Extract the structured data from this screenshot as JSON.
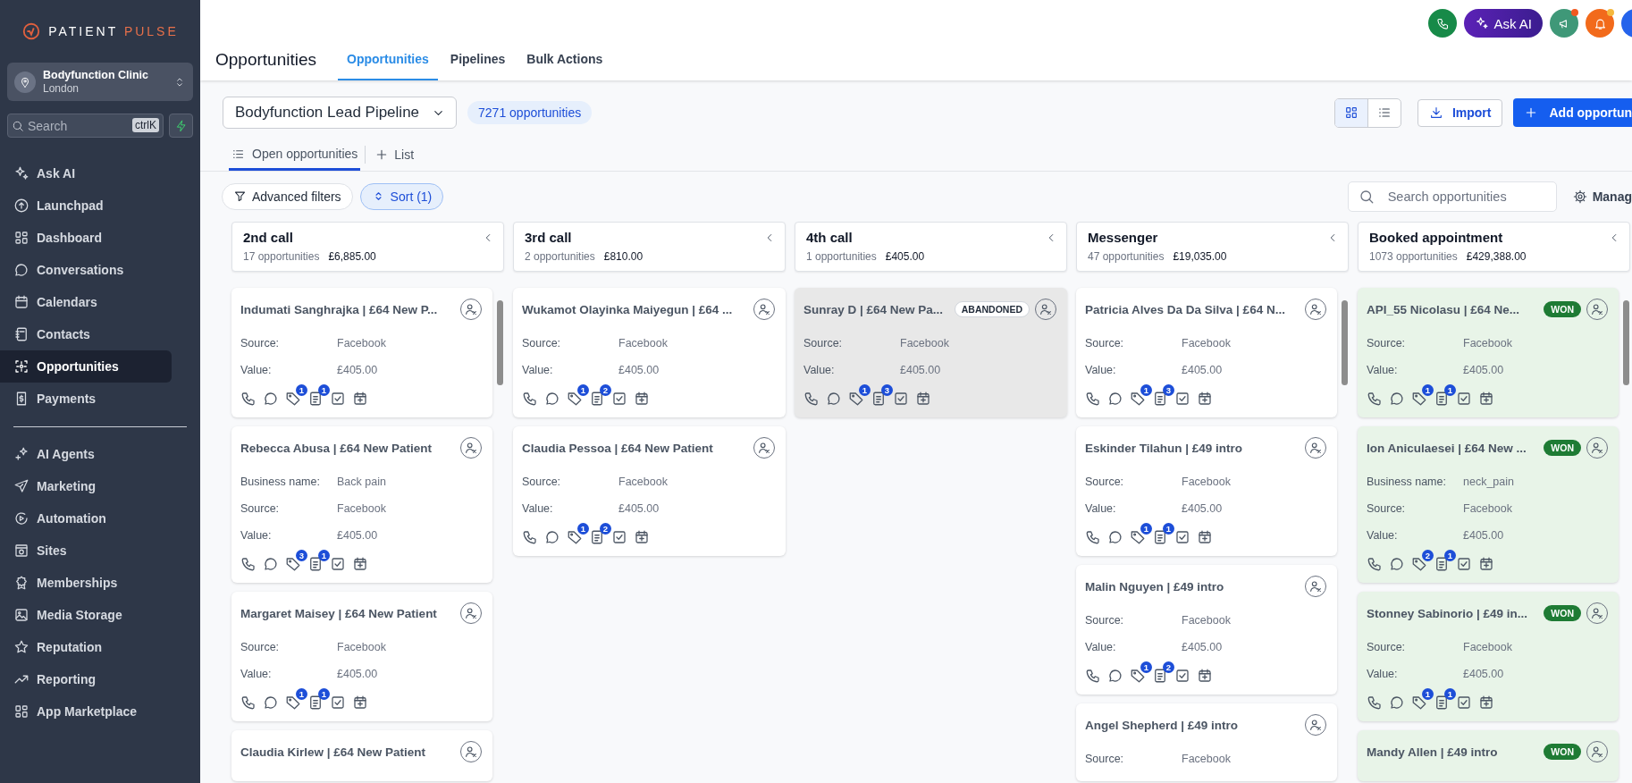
{
  "sidebar": {
    "logo": {
      "word_1": "PATIENT",
      "word_2": "PULSE"
    },
    "location": {
      "name": "Bodyfunction Clinic",
      "city": "London"
    },
    "search": {
      "placeholder": "Search",
      "shortcut": "ctrlK"
    },
    "groups": [
      {
        "items": [
          {
            "label": "Ask AI",
            "selected": false
          },
          {
            "label": "Launchpad",
            "selected": false
          },
          {
            "label": "Dashboard",
            "selected": false
          },
          {
            "label": "Conversations",
            "selected": false
          },
          {
            "label": "Calendars",
            "selected": false
          },
          {
            "label": "Contacts",
            "selected": false
          },
          {
            "label": "Opportunities",
            "selected": true
          },
          {
            "label": "Payments",
            "selected": false
          }
        ]
      },
      {
        "items": [
          {
            "label": "AI Agents",
            "selected": false
          },
          {
            "label": "Marketing",
            "selected": false
          },
          {
            "label": "Automation",
            "selected": false
          },
          {
            "label": "Sites",
            "selected": false
          },
          {
            "label": "Memberships",
            "selected": false
          },
          {
            "label": "Media Storage",
            "selected": false
          },
          {
            "label": "Reputation",
            "selected": false
          },
          {
            "label": "Reporting",
            "selected": false
          },
          {
            "label": "App Marketplace",
            "selected": false
          }
        ]
      }
    ]
  },
  "topbar": {
    "ask_ai": "Ask AI"
  },
  "header": {
    "title": "Opportunities",
    "tabs": [
      {
        "label": "Opportunities",
        "selected": true
      },
      {
        "label": "Pipelines",
        "selected": false
      },
      {
        "label": "Bulk Actions",
        "selected": false
      }
    ]
  },
  "toolbar": {
    "pipeline": "Bodyfunction Lead Pipeline",
    "count": "7271 opportunities",
    "views": [
      {
        "selected": true
      },
      {
        "selected": false
      }
    ],
    "import": "Import",
    "add": "Add opportun"
  },
  "views_tabs": [
    {
      "label": "Open opportunities",
      "selected": true
    }
  ],
  "add_list": "List",
  "filters": [
    {
      "label": "Advanced filters",
      "active": false
    },
    {
      "label": "Sort (1)",
      "active": true
    }
  ],
  "search": {
    "placeholder": "Search opportunities"
  },
  "manage": "Manag",
  "columns": [
    {
      "name": "2nd call",
      "count": "17 opportunities",
      "total": "£6,885.00",
      "cards": [
        {
          "title": "Indumati Sanghrajka | £64 New P...",
          "fields": [
            {
              "label": "Source:",
              "value": "Facebook"
            },
            {
              "label": "Value:",
              "value": "£405.00"
            }
          ],
          "actions": {
            "tags": "1",
            "notes": "1"
          }
        },
        {
          "title": "Rebecca Abusa | £64 New Patient",
          "fields": [
            {
              "label": "Business name:",
              "value": "Back pain"
            },
            {
              "label": "Source:",
              "value": "Facebook"
            },
            {
              "label": "Value:",
              "value": "£405.00"
            }
          ],
          "actions": {
            "tags": "3",
            "notes": "1"
          }
        },
        {
          "title": "Margaret Maisey | £64 New Patient",
          "fields": [
            {
              "label": "Source:",
              "value": "Facebook"
            },
            {
              "label": "Value:",
              "value": "£405.00"
            }
          ],
          "actions": {
            "tags": "1",
            "notes": "1"
          }
        },
        {
          "title": "Claudia Kirlew | £64 New Patient"
        }
      ]
    },
    {
      "name": "3rd call",
      "count": "2 opportunities",
      "total": "£810.00",
      "cards": [
        {
          "title": "Wukamot Olayinka Maiyegun | £64 ...",
          "fields": [
            {
              "label": "Source:",
              "value": "Facebook"
            },
            {
              "label": "Value:",
              "value": "£405.00"
            }
          ],
          "actions": {
            "tags": "1",
            "notes": "2"
          }
        },
        {
          "title": "Claudia Pessoa | £64 New Patient",
          "fields": [
            {
              "label": "Source:",
              "value": "Facebook"
            },
            {
              "label": "Value:",
              "value": "£405.00"
            }
          ],
          "actions": {
            "tags": "1",
            "notes": "2"
          }
        }
      ]
    },
    {
      "name": "4th call",
      "count": "1 opportunities",
      "total": "£405.00",
      "cards": [
        {
          "title": "Sunray D | £64 New Pa...",
          "badge": {
            "kind": "abandoned",
            "text": "ABANDONED"
          },
          "fields": [
            {
              "label": "Source:",
              "value": "Facebook"
            },
            {
              "label": "Value:",
              "value": "£405.00"
            }
          ],
          "actions": {
            "tags": "1",
            "notes": "3"
          }
        }
      ]
    },
    {
      "name": "Messenger",
      "count": "47 opportunities",
      "total": "£19,035.00",
      "cards": [
        {
          "title": "Patricia Alves Da Da Silva | £64 N...",
          "fields": [
            {
              "label": "Source:",
              "value": "Facebook"
            },
            {
              "label": "Value:",
              "value": "£405.00"
            }
          ],
          "actions": {
            "tags": "1",
            "notes": "3"
          }
        },
        {
          "title": "Eskinder Tilahun | £49 intro",
          "fields": [
            {
              "label": "Source:",
              "value": "Facebook"
            },
            {
              "label": "Value:",
              "value": "£405.00"
            }
          ],
          "actions": {
            "tags": "1",
            "notes": "1"
          }
        },
        {
          "title": "Malin Nguyen | £49 intro",
          "fields": [
            {
              "label": "Source:",
              "value": "Facebook"
            },
            {
              "label": "Value:",
              "value": "£405.00"
            }
          ],
          "actions": {
            "tags": "1",
            "notes": "2"
          }
        },
        {
          "title": "Angel Shepherd | £49 intro",
          "fields": [
            {
              "label": "Source:",
              "value": "Facebook"
            }
          ]
        }
      ]
    },
    {
      "name": "Booked appointment",
      "count": "1073 opportunities",
      "total": "£429,388.00",
      "cards": [
        {
          "title": "API_55 Nicolasu | £64 Ne...",
          "badge": {
            "kind": "won",
            "text": "WON"
          },
          "fields": [
            {
              "label": "Source:",
              "value": "Facebook"
            },
            {
              "label": "Value:",
              "value": "£405.00"
            }
          ],
          "actions": {
            "tags": "1",
            "notes": "1"
          }
        },
        {
          "title": "Ion Aniculaesei | £64 New ...",
          "badge": {
            "kind": "won",
            "text": "WON"
          },
          "fields": [
            {
              "label": "Business name:",
              "value": "neck_pain"
            },
            {
              "label": "Source:",
              "value": "Facebook"
            },
            {
              "label": "Value:",
              "value": "£405.00"
            }
          ],
          "actions": {
            "tags": "2",
            "notes": "1"
          }
        },
        {
          "title": "Stonney Sabinorio | £49 in...",
          "badge": {
            "kind": "won",
            "text": "WON"
          },
          "fields": [
            {
              "label": "Source:",
              "value": "Facebook"
            },
            {
              "label": "Value:",
              "value": "£405.00"
            }
          ],
          "actions": {
            "tags": "1",
            "notes": "1"
          }
        },
        {
          "title": "Mandy Allen | £49 intro",
          "badge": {
            "kind": "won",
            "text": "WON"
          }
        }
      ]
    }
  ]
}
